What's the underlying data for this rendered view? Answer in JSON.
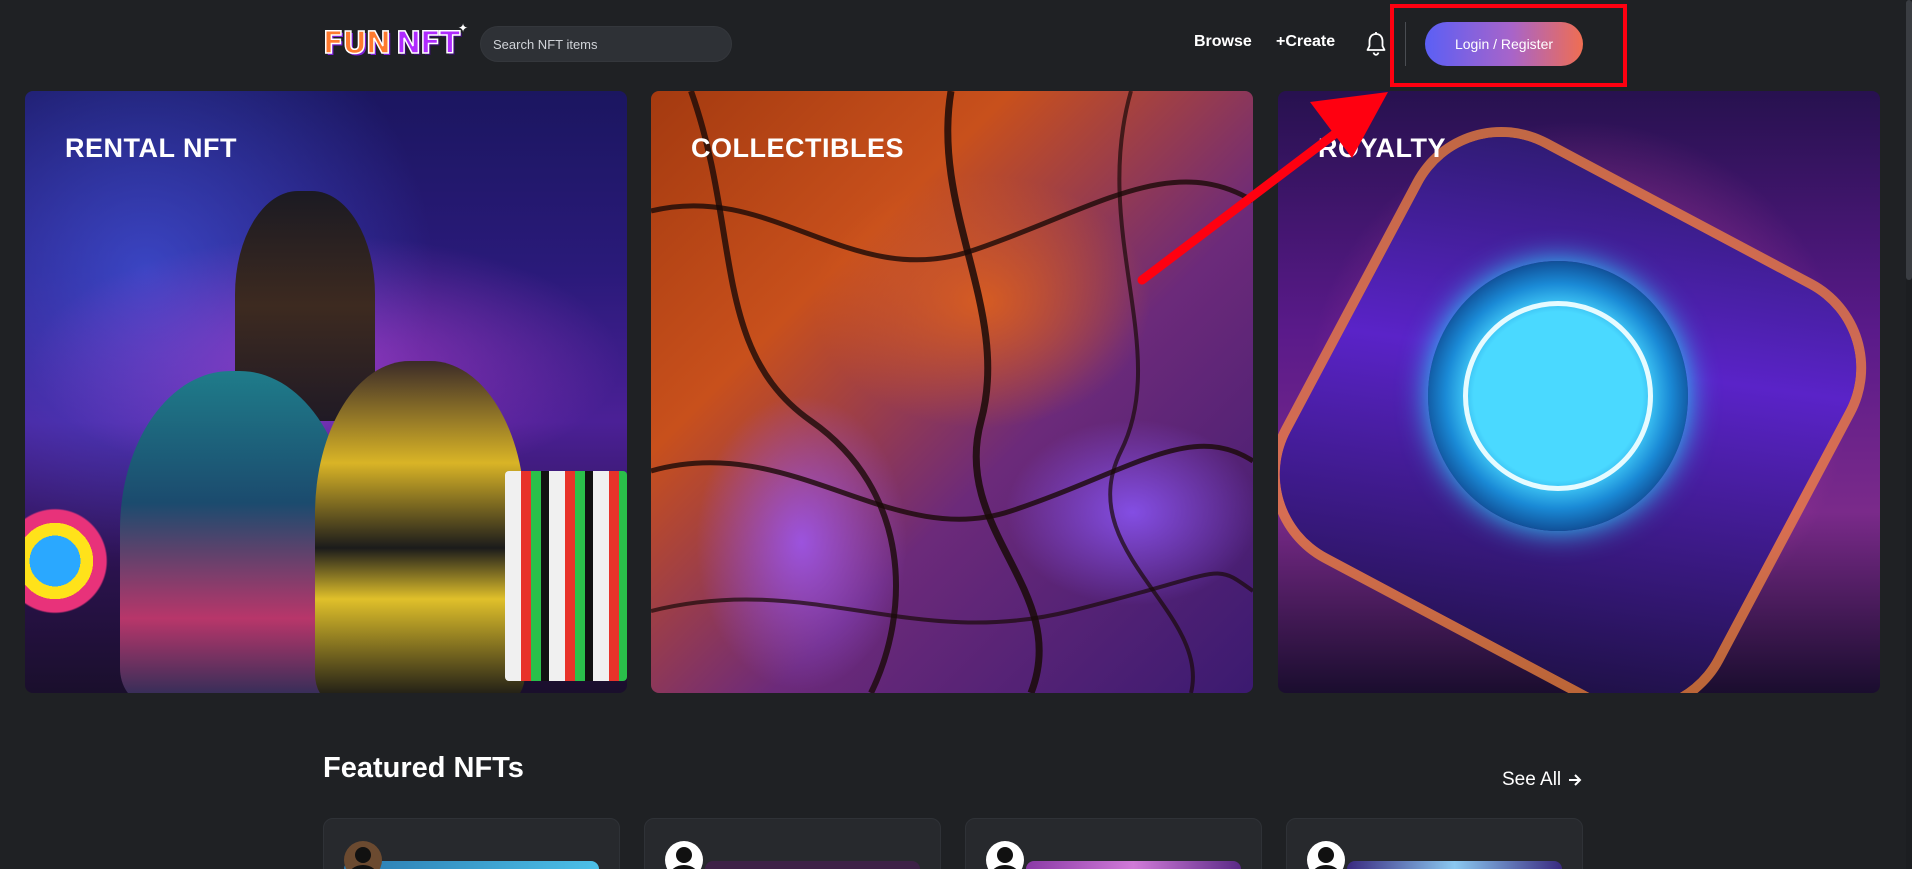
{
  "header": {
    "logo_text_fun": "FUN",
    "logo_text_nft": "NFT",
    "search_placeholder": "Search NFT items",
    "nav": {
      "browse": "Browse",
      "create": "+Create"
    },
    "login_button": "Login / Register"
  },
  "categories": [
    {
      "title": "RENTAL NFT"
    },
    {
      "title": "COLLECTIBLES"
    },
    {
      "title": "ROYALTY"
    }
  ],
  "featured": {
    "title": "Featured NFTs",
    "see_all": "See All"
  },
  "icons": {
    "notifications": "bell-icon",
    "see_all": "arrow-right-icon",
    "annotation": "red-arrow-annotation"
  },
  "colors": {
    "background": "#1f2124",
    "highlight": "#ff0010",
    "button_gradient_start": "#5b5ff5",
    "button_gradient_end": "#ef6e52"
  }
}
